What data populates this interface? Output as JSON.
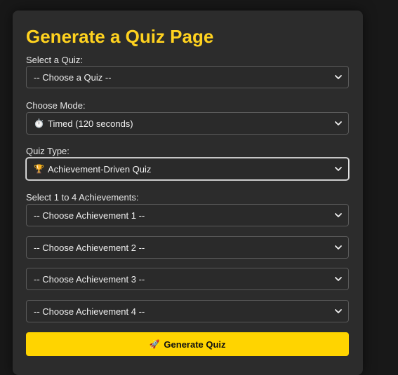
{
  "page_title": "Generate a Quiz Page",
  "quiz_select": {
    "label": "Select a Quiz:",
    "value": "-- Choose a Quiz --"
  },
  "mode_select": {
    "label": "Choose Mode:",
    "icon": "⏱️",
    "value": "Timed (120 seconds)"
  },
  "type_select": {
    "label": "Quiz Type:",
    "icon": "🏆",
    "value": "Achievement-Driven Quiz"
  },
  "achievements": {
    "label": "Select 1 to 4 Achievements:",
    "selects": [
      {
        "value": "-- Choose Achievement 1 --"
      },
      {
        "value": "-- Choose Achievement 2 --"
      },
      {
        "value": "-- Choose Achievement 3 --"
      },
      {
        "value": "-- Choose Achievement 4 --"
      }
    ]
  },
  "generate_button": {
    "icon": "🚀",
    "label": "Generate Quiz"
  },
  "colors": {
    "accent": "#ffd21f",
    "button": "#ffd400",
    "card": "#2c2c2c",
    "background": "#181818"
  }
}
